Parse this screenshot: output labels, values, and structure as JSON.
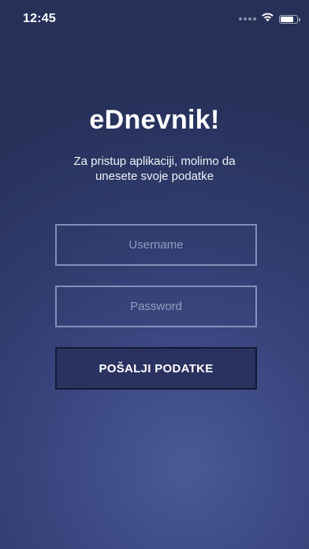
{
  "status_bar": {
    "time": "12:45",
    "battery_level": 0.8,
    "wifi_icon": "wifi-icon",
    "signal_icon": "cellular-signal-icon",
    "battery_icon": "battery-icon"
  },
  "login": {
    "app_title": "eDnevnik!",
    "subtitle": "Za pristup aplikaciji, molimo da unesete svoje podatke",
    "username_placeholder": "Username",
    "username_value": "",
    "password_placeholder": "Password",
    "password_value": "",
    "submit_label": "POŠALJI PODATKE"
  },
  "colors": {
    "background_top": "#263058",
    "background_glow": "#4a5a92",
    "field_border": "#a0acd2",
    "button_bg": "#2a3260",
    "button_border": "#141a36",
    "text": "#ffffff"
  }
}
